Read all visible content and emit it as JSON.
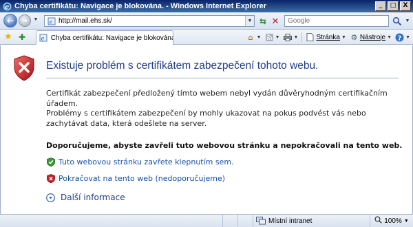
{
  "window": {
    "title": "Chyba certifikátu: Navigace je blokována. - Windows Internet Explorer",
    "minimize": "_",
    "maximize": "□",
    "close": "X"
  },
  "address_bar": {
    "url": "http://mail.ehs.sk/"
  },
  "search": {
    "placeholder": "Google"
  },
  "tab": {
    "label": "Chyba certifikátu: Navigace je blokována"
  },
  "command_bar": {
    "page_menu": "Stránka",
    "tools_menu": "Nástroje",
    "help": "?"
  },
  "content": {
    "heading": "Existuje problém s certifikátem zabezpečení tohoto webu.",
    "paragraph1": "Certifikát zabezpečení předložený tímto webem nebyl vydán důvěryhodným certifikačním úřadem.",
    "paragraph2": "Problémy s certifikátem zabezpečení by mohly ukazovat na pokus podvést vás nebo zachytávat data, která odešlete na server.",
    "recommendation": "Doporučujeme, abyste zavřeli tuto webovou stránku a nepokračovali na tento web.",
    "close_link": "Tuto webovou stránku zavřete klepnutím sem.",
    "continue_link": "Pokračovat na tento web (nedoporučujeme)",
    "more_info": "Další informace"
  },
  "status_bar": {
    "zone": "Místní intranet",
    "zoom": "100%"
  },
  "colors": {
    "title_bar": "#0a246a",
    "heading": "#1f3c88",
    "link": "#1550a8",
    "shield_red": "#c8202a",
    "shield_green": "#2a8a2a"
  },
  "icons": {
    "shield_big": "shield-error-icon",
    "close_link": "shield-ok-icon",
    "continue_link": "shield-error-icon",
    "more_info": "expand-circle-icon",
    "zone": "intranet-icon"
  }
}
